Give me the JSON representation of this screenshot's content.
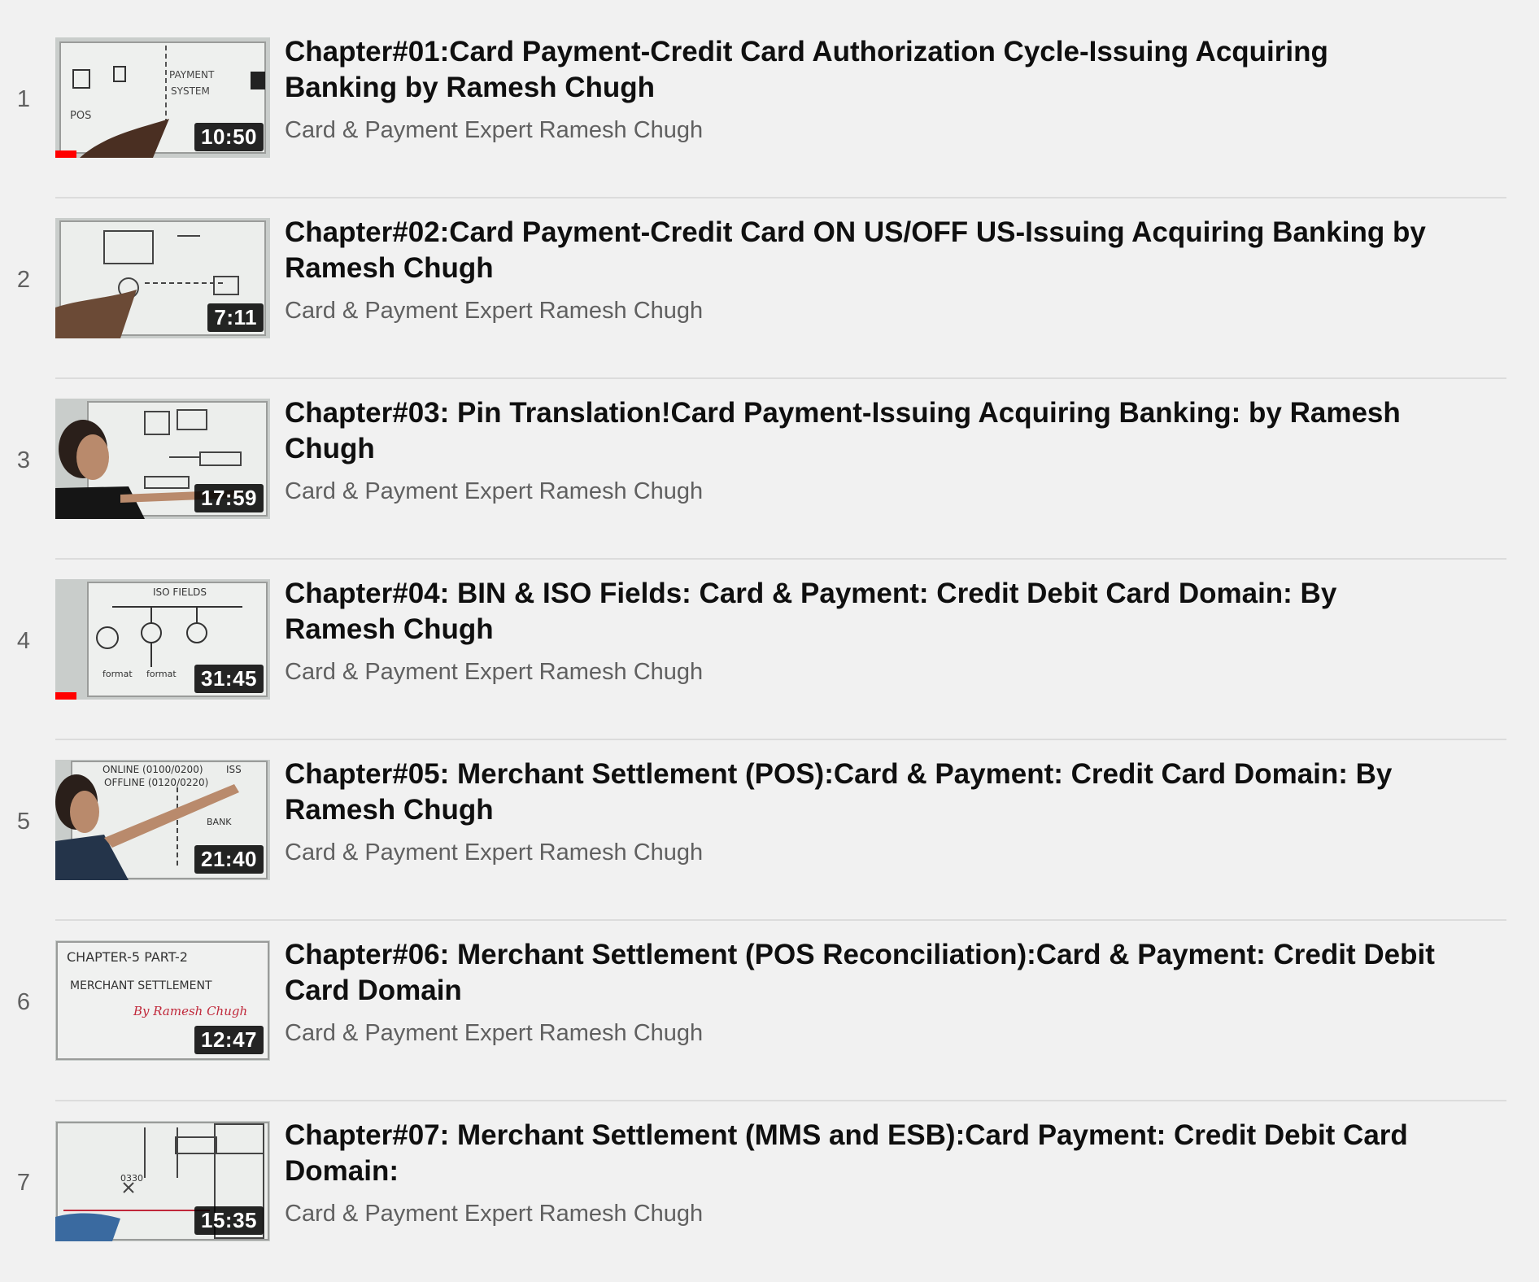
{
  "colors": {
    "background": "#f1f1f1",
    "title_text": "#0f0f0f",
    "secondary_text": "#606060",
    "progress_bar": "#ff0000",
    "duration_badge_bg": "#000000"
  },
  "playlist": {
    "items": [
      {
        "index": "1",
        "title": "Chapter#01:Card Payment-Credit Card Authorization Cycle-Issuing Acquiring Banking by Ramesh Chugh",
        "channel": "Card & Payment Expert Ramesh Chugh",
        "duration": "10:50",
        "watched_fraction": 0.1
      },
      {
        "index": "2",
        "title": "Chapter#02:Card Payment-Credit Card ON US/OFF US-Issuing Acquiring Banking by Ramesh Chugh",
        "channel": "Card & Payment Expert Ramesh Chugh",
        "duration": "7:11",
        "watched_fraction": 0
      },
      {
        "index": "3",
        "title": "Chapter#03: Pin Translation!Card Payment-Issuing Acquiring Banking: by Ramesh Chugh",
        "channel": "Card & Payment Expert Ramesh Chugh",
        "duration": "17:59",
        "watched_fraction": 0
      },
      {
        "index": "4",
        "title": "Chapter#04: BIN & ISO Fields: Card & Payment: Credit Debit Card Domain: By Ramesh Chugh",
        "channel": "Card & Payment Expert Ramesh Chugh",
        "duration": "31:45",
        "watched_fraction": 0.1
      },
      {
        "index": "5",
        "title": "Chapter#05: Merchant Settlement (POS):Card & Payment: Credit Card Domain: By Ramesh Chugh",
        "channel": "Card & Payment Expert Ramesh Chugh",
        "duration": "21:40",
        "watched_fraction": 0
      },
      {
        "index": "6",
        "title": "Chapter#06: Merchant Settlement (POS Reconciliation):Card & Payment: Credit Debit Card Domain",
        "channel": "Card & Payment Expert Ramesh Chugh",
        "duration": "12:47",
        "watched_fraction": 0
      },
      {
        "index": "7",
        "title": "Chapter#07: Merchant Settlement (MMS and ESB):Card Payment: Credit Debit Card Domain:",
        "channel": "Card & Payment Expert Ramesh Chugh",
        "duration": "15:35",
        "watched_fraction": 0
      }
    ]
  }
}
